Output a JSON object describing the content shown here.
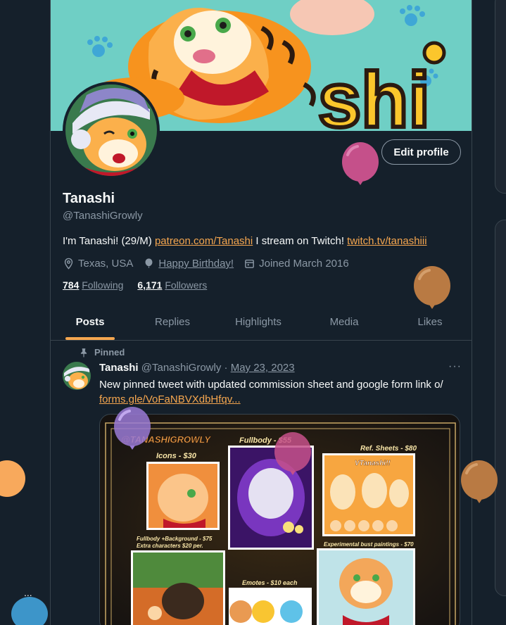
{
  "profile": {
    "name": "Tanashi",
    "handle": "@TanashiGrowly",
    "edit_label": "Edit profile",
    "bio_text_1": "I'm Tanashi! (29/M) ",
    "bio_link_1": "patreon.com/Tanashi",
    "bio_text_2": " I stream on Twitch! ",
    "bio_link_2": "twitch.tv/tanashiii",
    "location": "Texas, USA",
    "birthday": "Happy Birthday!",
    "joined": "Joined March 2016",
    "following_count": "784",
    "following_label": "Following",
    "followers_count": "6,171",
    "followers_label": "Followers"
  },
  "tabs": [
    "Posts",
    "Replies",
    "Highlights",
    "Media",
    "Likes"
  ],
  "active_tab": "Posts",
  "pinned_tweet": {
    "pinned_label": "Pinned",
    "author": "Tanashi",
    "handle": "@TanashiGrowly",
    "separator": "·",
    "date": "May 23, 2023",
    "more": "···",
    "text": "New pinned tweet with updated commission sheet and google form link o/",
    "link": "forms.gle/VoFaNBVXdbHfqv...",
    "media": {
      "header": "@TANASHIGROWLY",
      "icons": "Icons - $30",
      "fullbody": "Fullbody - $55",
      "ref_sheets": "Ref. Sheets - $80",
      "ref_sheet_name": "VTanashi!!",
      "fullbody_bg_1": "Fullbody +Background - $75",
      "fullbody_bg_2": "Extra characters $20 per.",
      "emotes": "Emotes - $10 each",
      "experimental": "Experimental bust paintings - $70"
    }
  },
  "banner_text": "Tanashi",
  "colors": {
    "bg": "#15202b",
    "accent": "#f5a64f",
    "border": "#38444d",
    "muted": "#8b98a5",
    "balloon_pink": "#c5508a",
    "balloon_brown": "#b97a43",
    "balloon_purple": "#9a7ad6",
    "balloon_blue": "#3d95c9"
  },
  "icons": [
    "location-icon",
    "balloon-icon",
    "calendar-icon",
    "pin-icon"
  ]
}
